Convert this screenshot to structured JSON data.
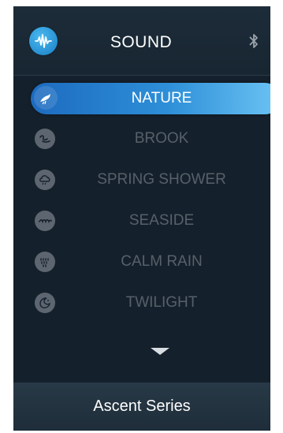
{
  "header": {
    "title": "SOUND",
    "app_icon": "sound-wave-icon",
    "bluetooth_icon": "bluetooth-icon"
  },
  "sounds": [
    {
      "label": "NATURE",
      "icon": "bird-icon",
      "selected": true
    },
    {
      "label": "BROOK",
      "icon": "brook-icon",
      "selected": false
    },
    {
      "label": "SPRING SHOWER",
      "icon": "cloud-rain-icon",
      "selected": false
    },
    {
      "label": "SEASIDE",
      "icon": "waves-icon",
      "selected": false
    },
    {
      "label": "CALM RAIN",
      "icon": "rain-drops-icon",
      "selected": false
    },
    {
      "label": "TWILIGHT",
      "icon": "moon-icon",
      "selected": false
    }
  ],
  "more_icon": "chevron-down-icon",
  "footer": {
    "label": "Ascent Series"
  },
  "colors": {
    "background": "#14202b",
    "accent": "#2e8fd8",
    "inactive_text": "#56606a"
  }
}
